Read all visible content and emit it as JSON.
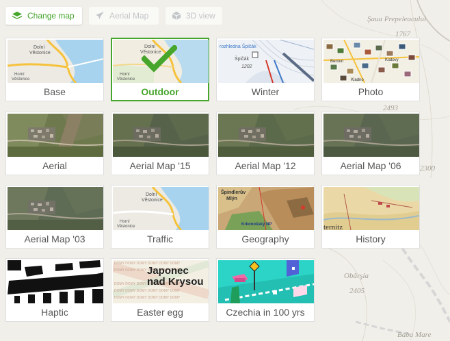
{
  "toolbar": {
    "change_map": {
      "label": "Change map",
      "icon": "layers-icon",
      "color": "#46a52b"
    },
    "aerial_map": {
      "label": "Aerial Map",
      "icon": "airplane-icon"
    },
    "view_3d": {
      "label": "3D view",
      "icon": "cube-icon"
    }
  },
  "selected_map": "Outdoor",
  "accent_color": "#46a52b",
  "tiles": [
    {
      "label": "Base",
      "icon": "base-map-thumbnail",
      "selected": false,
      "thumb_text": [
        "Dolní",
        "Věstonice",
        "Horní",
        "Věstonice"
      ]
    },
    {
      "label": "Outdoor",
      "icon": "outdoor-map-thumbnail",
      "selected": true,
      "thumb_text": [
        "Dolní",
        "Věstonice",
        "Horní",
        "Věstonice"
      ]
    },
    {
      "label": "Winter",
      "icon": "winter-map-thumbnail",
      "selected": false,
      "thumb_text": [
        "rozhledna Špičák",
        "Špičák",
        "1202"
      ]
    },
    {
      "label": "Photo",
      "icon": "photo-map-thumbnail",
      "selected": false,
      "thumb_text": [
        "Klatovy",
        "Beroun",
        "Kladno",
        "Beroun"
      ]
    },
    {
      "label": "Aerial",
      "icon": "aerial-map-thumbnail",
      "selected": false
    },
    {
      "label": "Aerial Map '15",
      "icon": "aerial-map-thumbnail",
      "selected": false
    },
    {
      "label": "Aerial Map '12",
      "icon": "aerial-map-thumbnail",
      "selected": false
    },
    {
      "label": "Aerial Map '06",
      "icon": "aerial-map-thumbnail",
      "selected": false
    },
    {
      "label": "Aerial Map '03",
      "icon": "aerial-map-thumbnail",
      "selected": false
    },
    {
      "label": "Traffic",
      "icon": "traffic-map-thumbnail",
      "selected": false,
      "thumb_text": [
        "Dolní",
        "Věstonice",
        "Horní",
        "Věstonice"
      ]
    },
    {
      "label": "Geography",
      "icon": "geography-map-thumbnail",
      "selected": false,
      "thumb_text": [
        "Špindlerův",
        "Mlýn",
        "Krkonošský NP"
      ]
    },
    {
      "label": "History",
      "icon": "history-map-thumbnail",
      "selected": false,
      "thumb_text": [
        "ternitz"
      ]
    },
    {
      "label": "Haptic",
      "icon": "haptic-map-thumbnail",
      "selected": false
    },
    {
      "label": "Easter egg",
      "icon": "easter-egg-thumbnail",
      "selected": false,
      "thumb_text": [
        "Japonec",
        "nad Krysou"
      ]
    },
    {
      "label": "Czechia in 100 yrs",
      "icon": "future-map-thumbnail",
      "selected": false
    }
  ],
  "background_map": {
    "labels": [
      "Şaua Prepeleacului",
      "1767",
      "2493",
      "2300",
      "Obârşia",
      "2405",
      "Baba Mare"
    ]
  }
}
